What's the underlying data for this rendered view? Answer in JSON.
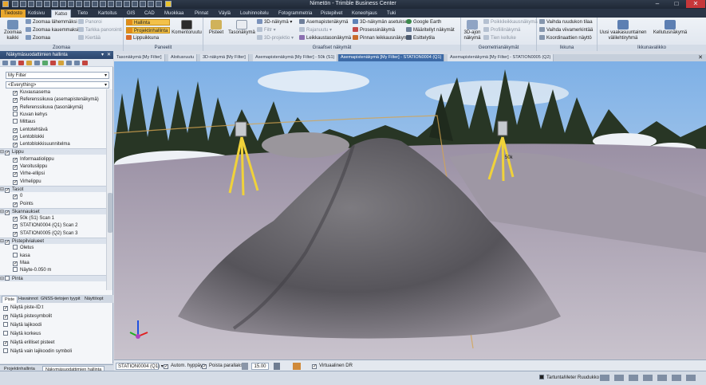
{
  "window": {
    "title": "Nimetön - Trimble Business Center"
  },
  "ribbon_tabs": [
    "Tiedosto",
    "Kotisivu",
    "Katso",
    "Tieto",
    "Kartoitus",
    "GIS",
    "CAD",
    "Muokkaa",
    "Pinnat",
    "Väylä",
    "Louhinnoitelu",
    "Fotogrammetria",
    "Pistepilvet",
    "Koneohjaus",
    "Tuki"
  ],
  "active_tab": "Katso",
  "ribbon": {
    "zoom": {
      "label": "Zoomaa",
      "zoom_all": "Zoomaa kaikki",
      "items": [
        "Zoomaa lähemmäksi",
        "Zoomaa kauemmaksi",
        "Zoomaa",
        "Panoroi",
        "Tarkka panorointi",
        "Kiertää"
      ]
    },
    "panels": {
      "label": "Paneelit",
      "items": [
        "Hallinta",
        "Projektinhallinta",
        "Lippuikkuna"
      ],
      "komentoruutu": "Komentoruutu"
    },
    "graphic_views": {
      "label": "Graafiset näkymät",
      "pisteet": "Pisteet",
      "tasonakyma": "Tasonäkymä",
      "col1": [
        "3D-näkymä",
        "Filtr",
        "3D-projektio"
      ],
      "col2": [
        "Asemapistenäkymä",
        "Rajanuutu",
        "Leikkaustasonäkymä"
      ],
      "col3": [
        "3D-näkymän asetukset",
        "Prosessinäkymä",
        "Pinnan leikkausnäkymä"
      ],
      "col4": [
        "Google Earth",
        "Määritellyt näkymät",
        "Esittelytila"
      ]
    },
    "geometry": {
      "label": "Geometrianäkymät",
      "big": "3D-ajon näkymä",
      "items": [
        "Poikkileikkausnäkymä",
        "Profiilinäkymä",
        "Tien kelluke"
      ]
    },
    "window_group": {
      "label": "Ikkuna",
      "items": [
        "Vaihda ruudukon tilaa",
        "Vaihda viivamerkintää",
        "Koordinaattien näyttö"
      ]
    },
    "window_list": {
      "label": "Ikkunavalikko",
      "vertical": "Uusi vaakasuuntainen välilehtiryhmä",
      "floating": "Kellutusnäkymä"
    }
  },
  "left_panel": {
    "title": "Näkymäsuodattimien hallinta",
    "filter_select": "My Filter",
    "everything_select": "<Everything>",
    "tree": [
      {
        "type": "item",
        "label": "Kuvausasema",
        "checked": true
      },
      {
        "type": "item",
        "label": "Referenssikuva (asemapistenäkymä)",
        "checked": true
      },
      {
        "type": "item",
        "label": "Referenssikuva (tasonäkymä)",
        "checked": true
      },
      {
        "type": "item",
        "label": "Kuvan kehys",
        "checked": false
      },
      {
        "type": "item",
        "label": "Mittaus",
        "checked": false
      },
      {
        "type": "item",
        "label": "Lentotehtävä",
        "checked": true
      },
      {
        "type": "item",
        "label": "Lentoblokki",
        "checked": true
      },
      {
        "type": "item",
        "label": "Lentoblokkisuunnitelma",
        "checked": true
      },
      {
        "type": "cat",
        "label": "Lippu",
        "checked": true
      },
      {
        "type": "item",
        "label": "Informaatiolippu",
        "checked": true
      },
      {
        "type": "item",
        "label": "Varoituslippu",
        "checked": true
      },
      {
        "type": "item",
        "label": "Virhe-ellipsi",
        "checked": true
      },
      {
        "type": "item",
        "label": "Virhelippu",
        "checked": true
      },
      {
        "type": "cat",
        "label": "Tasot",
        "checked": true
      },
      {
        "type": "item",
        "label": "0",
        "checked": true
      },
      {
        "type": "item",
        "label": "Points",
        "checked": true
      },
      {
        "type": "cat",
        "label": "Skannaukset",
        "checked": true
      },
      {
        "type": "item",
        "label": "50k (S1) Scan 1",
        "checked": true
      },
      {
        "type": "item",
        "label": "STATION0004 (Q1) Scan 2",
        "checked": true
      },
      {
        "type": "item",
        "label": "STATION0005 (Q2) Scan 3",
        "checked": true
      },
      {
        "type": "cat",
        "label": "Pistepilvialueet",
        "checked": true
      },
      {
        "type": "item",
        "label": "Oletus",
        "checked": false
      },
      {
        "type": "item",
        "label": "kasa",
        "checked": false
      },
      {
        "type": "item",
        "label": "Maa",
        "checked": true
      },
      {
        "type": "item",
        "label": "Näyte-0.050 m",
        "checked": false
      },
      {
        "type": "cat",
        "label": "Pinta",
        "checked": false
      }
    ],
    "bottom_tabs": [
      "Piste",
      "Havainnot",
      "GNSS-tietojen tyypit",
      "Näyttöopt"
    ],
    "options": [
      {
        "label": "Näytä piste-ID:t",
        "checked": true
      },
      {
        "label": "Näytä pistesymbolit",
        "checked": true
      },
      {
        "label": "Näytä lajikoodi",
        "checked": false
      },
      {
        "label": "Näytä korkeus",
        "checked": false
      },
      {
        "label": "Näytä erilliset pisteet",
        "checked": true
      },
      {
        "label": "Näytä vain lajikoodin symboli",
        "checked": false
      }
    ],
    "footer_tabs": [
      "Projektinhallinta",
      "Näkymäsuodattimien hallinta"
    ]
  },
  "doc_tabs": [
    "Tasonäkymä [My Filter]",
    "Aloitusruutu",
    "3D-näkymä [My Filter]",
    "Asemapistenäkymä [My Filter] - 50k (S1)",
    "Asemapistenäkymä [My Filter] - STATION0004 (Q1)",
    "Asemapistenäkymä [My Filter] - STATION0005 (Q2)"
  ],
  "active_doc_tab": 4,
  "viewport": {
    "scanner_label": "50k",
    "axis_colors": {
      "x": "#e02020",
      "y": "#20b020",
      "z": "#2050e0"
    }
  },
  "view_bar": {
    "station": "STATION0004 (Q1)",
    "auto_jump": "Autom. hyppäys",
    "parallax": "Poista parallaksi",
    "zoom_value": "15.00",
    "virtual_dr": "Virtuaalinen DR"
  },
  "status_bar": {
    "snap": "Tartunta",
    "units": "Meter",
    "grid": "Ruudukko"
  },
  "colors": {
    "file_tab": "#e8a72d",
    "active_doc_tab": "#3d6aa6",
    "panel_header": "#2c466d"
  }
}
